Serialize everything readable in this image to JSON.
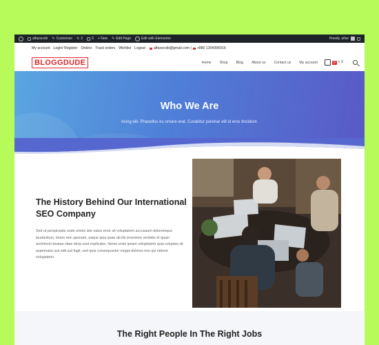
{
  "adminbar": {
    "items": [
      "alfazscoib",
      "Customize",
      "3",
      "0",
      "+ New",
      "Edit Page",
      "Edit with Elementor"
    ],
    "howdy": "Howdy, alfaz"
  },
  "topbar": {
    "links": [
      "My account",
      "Login/ Register",
      "Orders",
      "Track orders",
      "Wishlist",
      "Logout"
    ],
    "email": "alfazscoib@gmail.com |",
    "phone": "+880 1304396916"
  },
  "header": {
    "logo": "BLOGGDUDE",
    "nav": [
      "Home",
      "Shop",
      "Blog",
      "About us",
      "Contact us",
      "My account"
    ],
    "cart_count": "0",
    "cart_total": "৳ 0"
  },
  "hero": {
    "title": "Who We Are",
    "subtitle": "Acing elit. Phasellus eu ornare erat. Curabitur pulvinar elit id eros tincidunt."
  },
  "about": {
    "title": "The History Behind Our International SEO Company",
    "text": "Sed ut perspiciatis unde omnis iste natus error sit voluptatem accusaum doloremque laudantium, totam rem aperiam, eaque ipsa quae ab illo inventore veritatis et quasi architecto beatae vitae dicta sunt explicabo. Nemo enim ipsam voluptatem quia voluptas sit aspernatur aut odit aut fugit, sed quia consequuntur magni dolores eos qui ratione voluptatem."
  },
  "section2": {
    "title": "The Right People In The Right Jobs"
  },
  "colors": {
    "background": "#b6fb5a",
    "adminbar": "#1d2327",
    "brand_red": "#d8262d",
    "hero_start": "#5aa6e0",
    "hero_end": "#5a59c6"
  }
}
